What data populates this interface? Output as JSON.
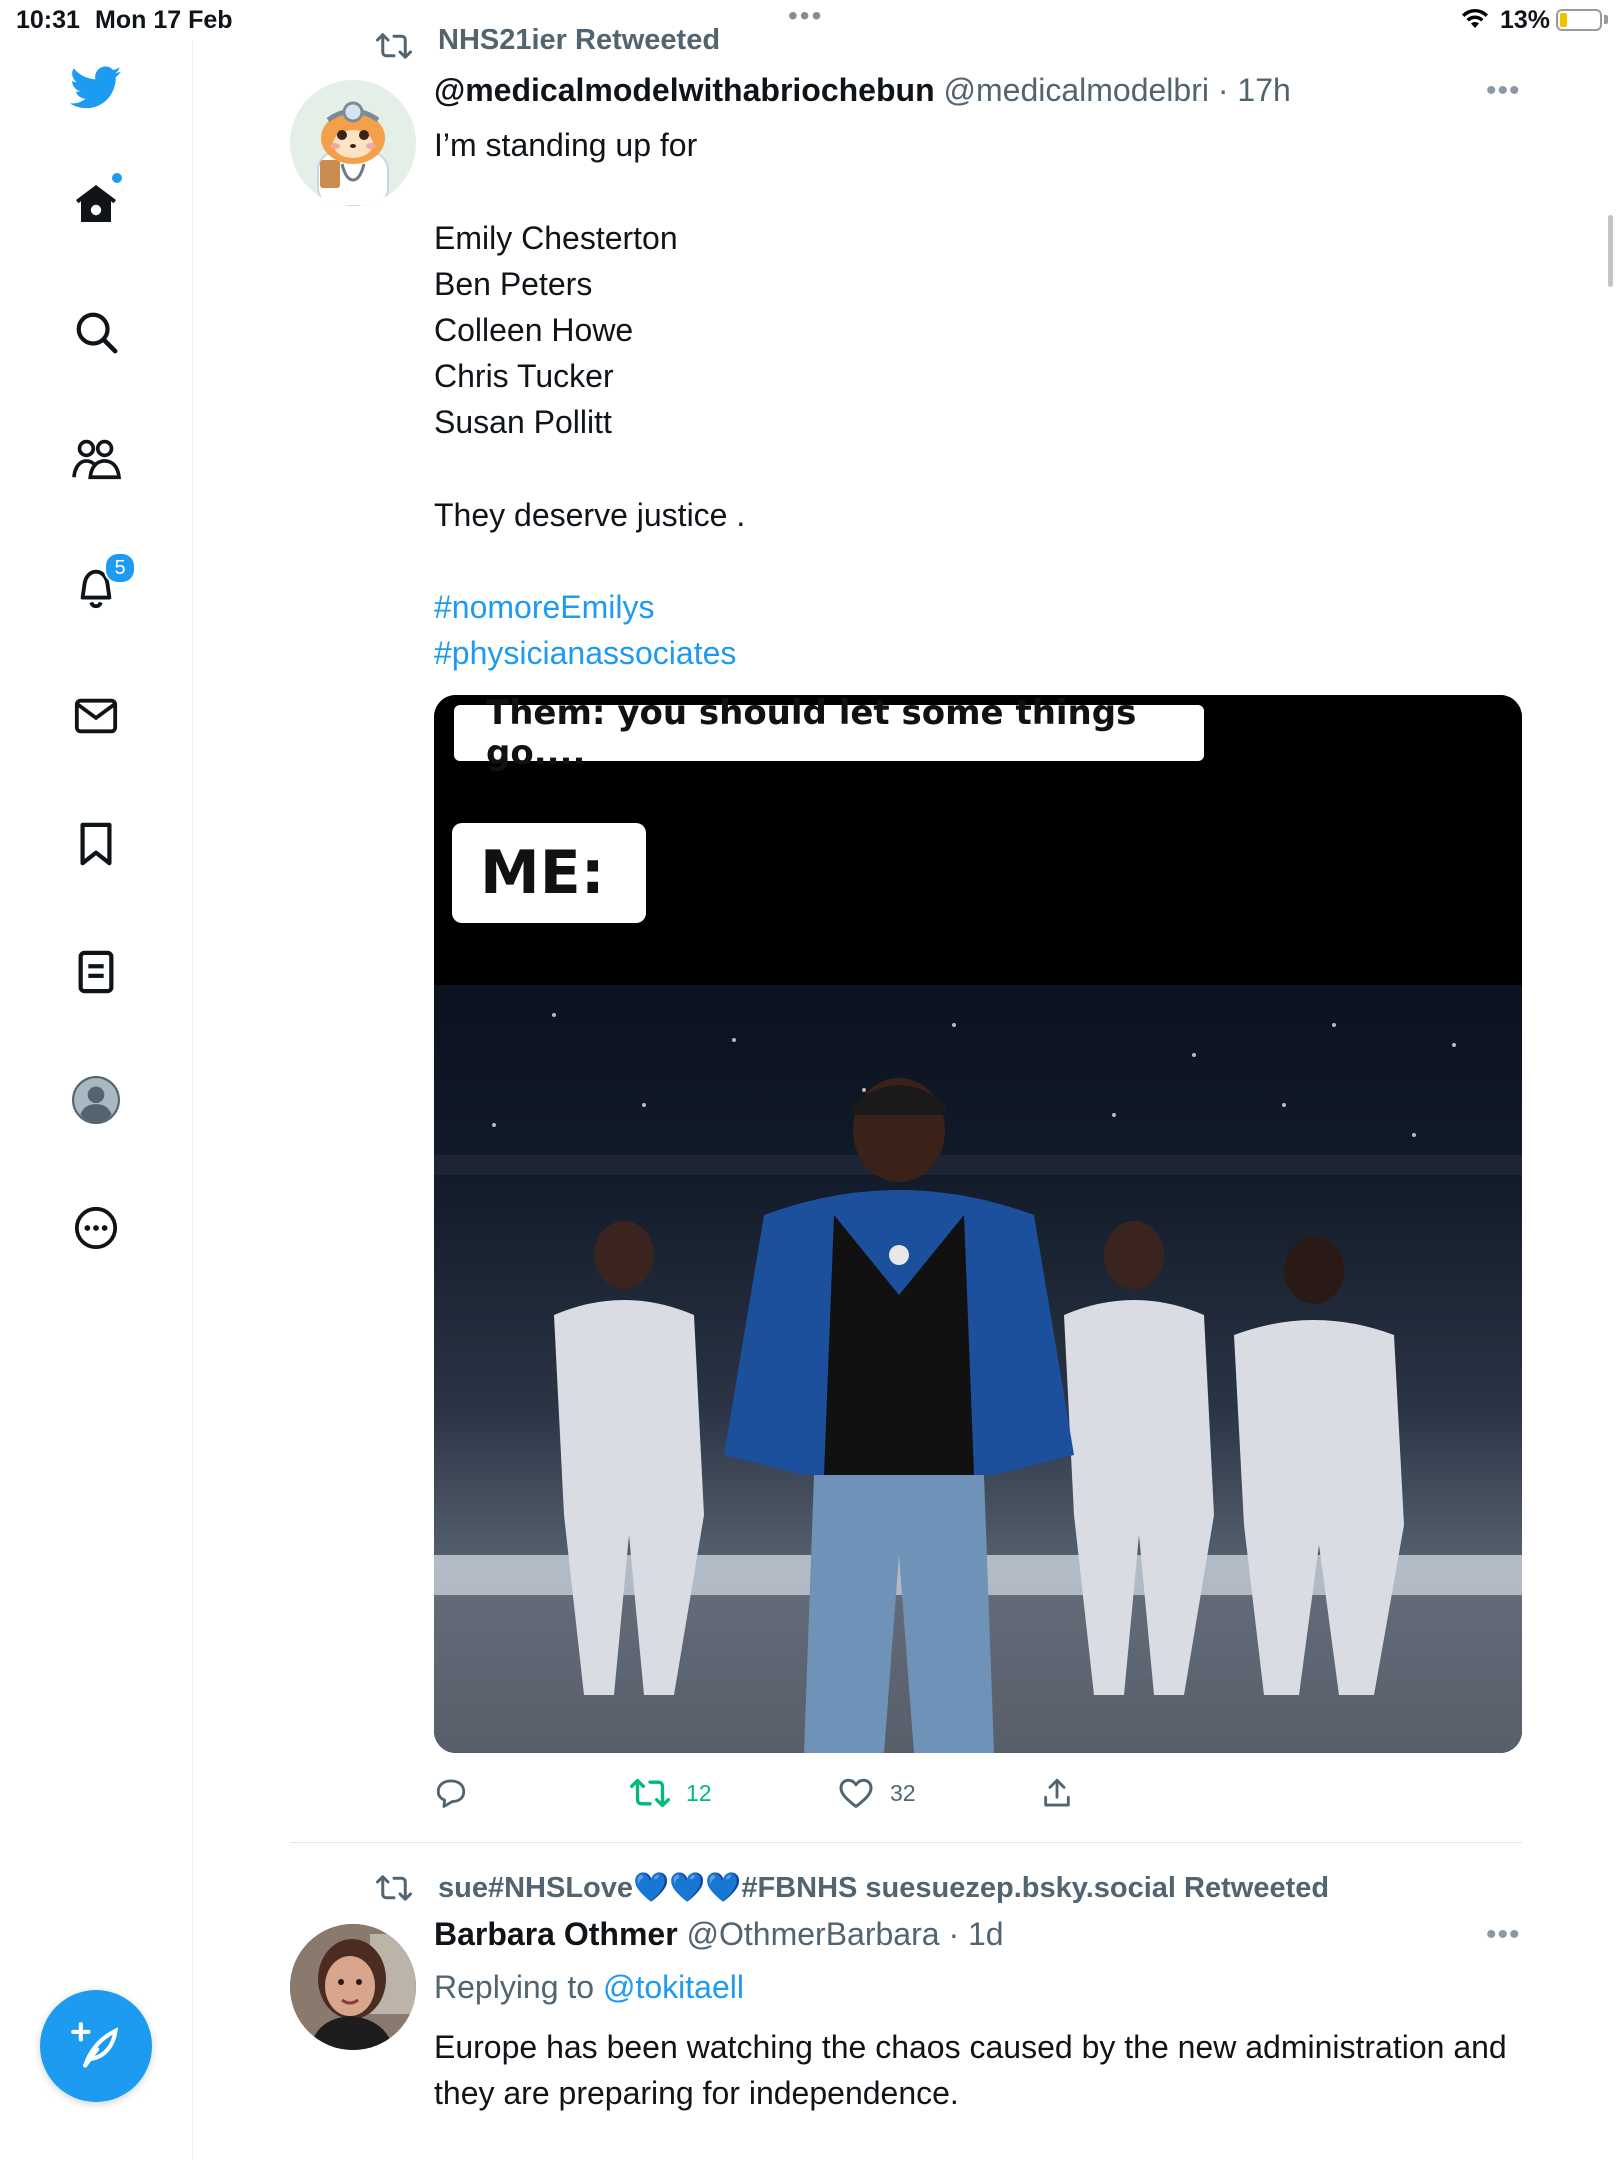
{
  "status_bar": {
    "time": "10:31",
    "date": "Mon 17 Feb",
    "battery": "13%"
  },
  "sidebar": {
    "items": [
      {
        "name": "twitter-logo",
        "icon": "bird-icon"
      },
      {
        "name": "home",
        "icon": "home-icon"
      },
      {
        "name": "explore",
        "icon": "search-icon"
      },
      {
        "name": "communities",
        "icon": "people-icon"
      },
      {
        "name": "notifications",
        "icon": "bell-icon",
        "badge": "5"
      },
      {
        "name": "messages",
        "icon": "envelope-icon"
      },
      {
        "name": "bookmarks",
        "icon": "bookmark-icon"
      },
      {
        "name": "lists",
        "icon": "list-icon"
      },
      {
        "name": "profile",
        "icon": "avatar-icon"
      },
      {
        "name": "more",
        "icon": "more-circle-icon"
      }
    ],
    "compose_icon": "feather-plus-icon"
  },
  "tweets": [
    {
      "retweeted_by": "NHS21ier Retweeted",
      "display_name": "@medicalmodelwithabriochebun",
      "handle_time": "@medicalmodelbri · 17h",
      "body_intro": "I’m standing up for",
      "names": "Emily Chesterton\nBen Peters\nColleen Howe\nChris Tucker\nSusan Pollitt",
      "body_outro": "They deserve  justice .",
      "hashtags": [
        "#nomoreEmilys",
        "#physicianassociates"
      ],
      "media": {
        "caption_top": "Them: you should let some things go....",
        "caption_me": "ME:"
      },
      "actions": {
        "reply_count": "",
        "retweet_count": "12",
        "like_count": "32"
      }
    },
    {
      "retweeted_by": "sue#NHSLove💙💙💙#FBNHS suesuezep.bsky.social Retweeted",
      "display_name": "Barbara Othmer",
      "handle_time": "@OthmerBarbara · 1d",
      "replying_prefix": "Replying to ",
      "replying_to": "@tokitaell",
      "body": "Europe has been watching the chaos caused by the new administration and they are preparing for independence."
    }
  ],
  "colors": {
    "accent": "#1d9bf0",
    "retweet_green": "#00ba7c",
    "secondary_text": "#536471"
  }
}
